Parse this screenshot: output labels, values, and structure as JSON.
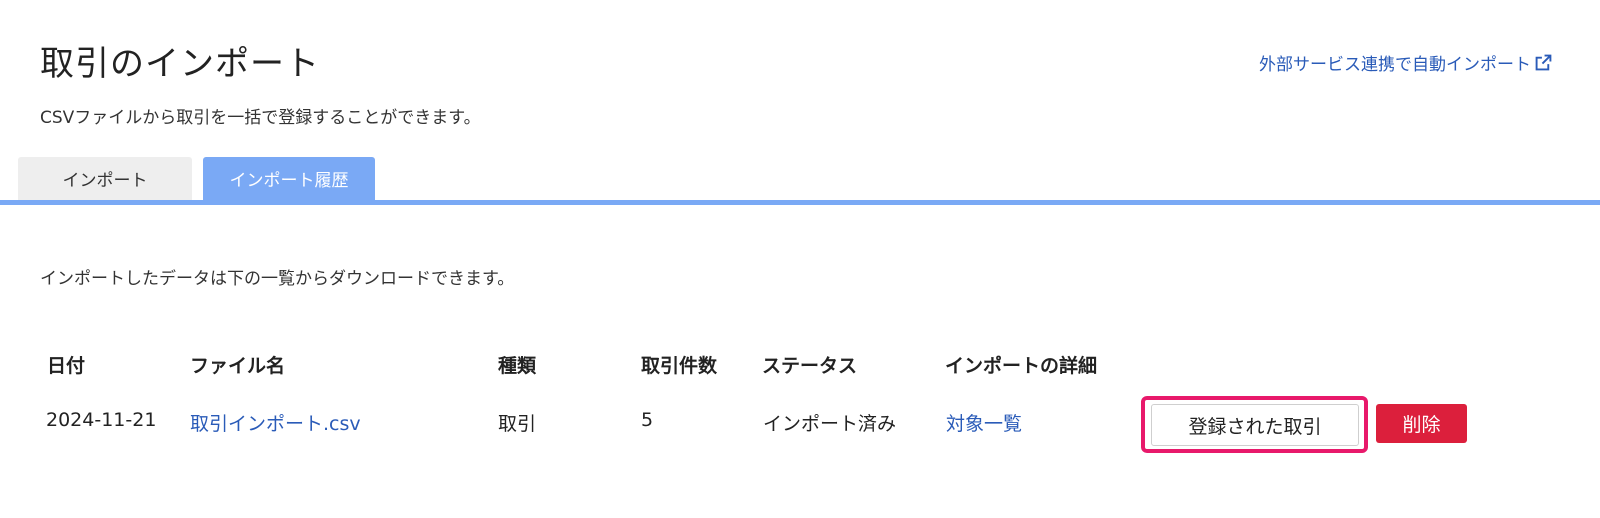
{
  "header": {
    "title": "取引のインポート",
    "subtitle": "CSVファイルから取引を一括で登録することができます。",
    "external_link": "外部サービス連携で自動インポート"
  },
  "tabs": [
    {
      "label": "インポート",
      "active": false
    },
    {
      "label": "インポート履歴",
      "active": true
    }
  ],
  "history": {
    "description": "インポートしたデータは下の一覧からダウンロードできます。",
    "columns": [
      "日付",
      "ファイル名",
      "種類",
      "取引件数",
      "ステータス",
      "インポートの詳細"
    ],
    "rows": [
      {
        "date": "2024-11-21",
        "file_name": "取引インポート.csv",
        "type": "取引",
        "count": "5",
        "status": "インポート済み",
        "detail": "対象一覧",
        "registered_button": "登録された取引",
        "delete_button": "削除"
      }
    ]
  },
  "colors": {
    "accent": "#7aa9f5",
    "link": "#2a5bb8",
    "danger": "#dc1f3c",
    "highlight": "#e8196b"
  },
  "icons": {
    "external": "external-link-icon"
  }
}
